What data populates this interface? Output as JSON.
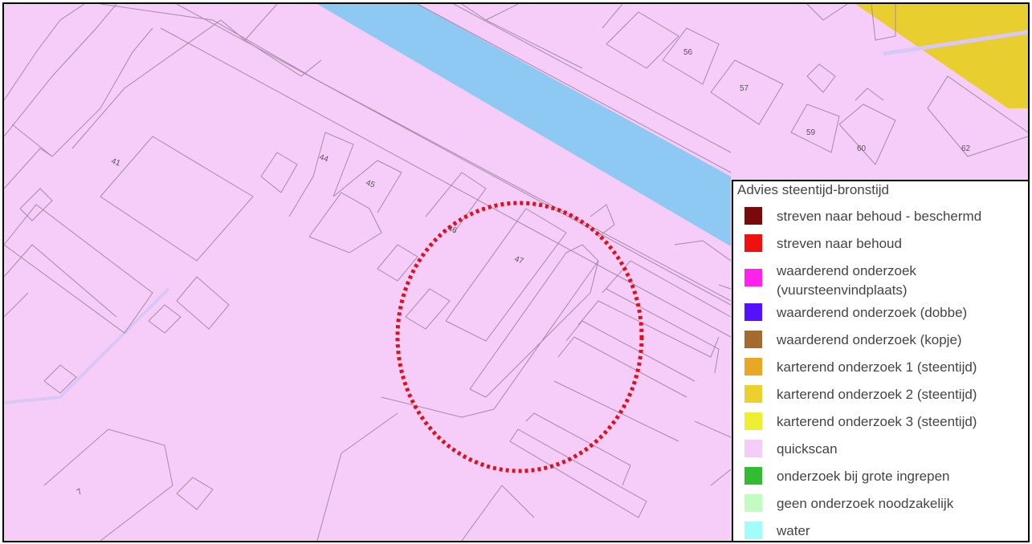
{
  "map": {
    "parcel_labels": [
      {
        "text": "41"
      },
      {
        "text": "44"
      },
      {
        "text": "45"
      },
      {
        "text": "46"
      },
      {
        "text": "47"
      },
      {
        "text": "56"
      },
      {
        "text": "57"
      },
      {
        "text": "59"
      },
      {
        "text": "60"
      },
      {
        "text": "62"
      },
      {
        "text": "7"
      }
    ],
    "colors": {
      "background": "#f5cdf8",
      "water": "#8ec9f3",
      "yellow_zone": "#e8ce2e",
      "parcel_line": "#a78aa6",
      "circle": "#e0101a"
    }
  },
  "legend": {
    "title": "Advies steentijd-bronstijd",
    "items": [
      {
        "label": "streven naar behoud - beschermd",
        "color": "#7a0a0a"
      },
      {
        "label": "streven naar behoud",
        "color": "#ee1111"
      },
      {
        "label": "waarderend onderzoek",
        "label2": "(vuursteenvindplaats)",
        "color": "#ff22ee"
      },
      {
        "label": "waarderend onderzoek (dobbe)",
        "color": "#5511ff"
      },
      {
        "label": "waarderend onderzoek (kopje)",
        "color": "#a56a2e"
      },
      {
        "label": "karterend onderzoek 1 (steentijd)",
        "color": "#eaa723"
      },
      {
        "label": "karterend onderzoek 2 (steentijd)",
        "color": "#ecd02d"
      },
      {
        "label": "karterend onderzoek 3 (steentijd)",
        "color": "#eeee33"
      },
      {
        "label": "quickscan",
        "color": "#f5cdf8"
      },
      {
        "label": "onderzoek bij grote ingrepen",
        "color": "#33bb33"
      },
      {
        "label": "geen onderzoek noodzakelijk",
        "color": "#c2fcc2"
      },
      {
        "label": "water",
        "color": "#a3fcfc"
      }
    ]
  }
}
